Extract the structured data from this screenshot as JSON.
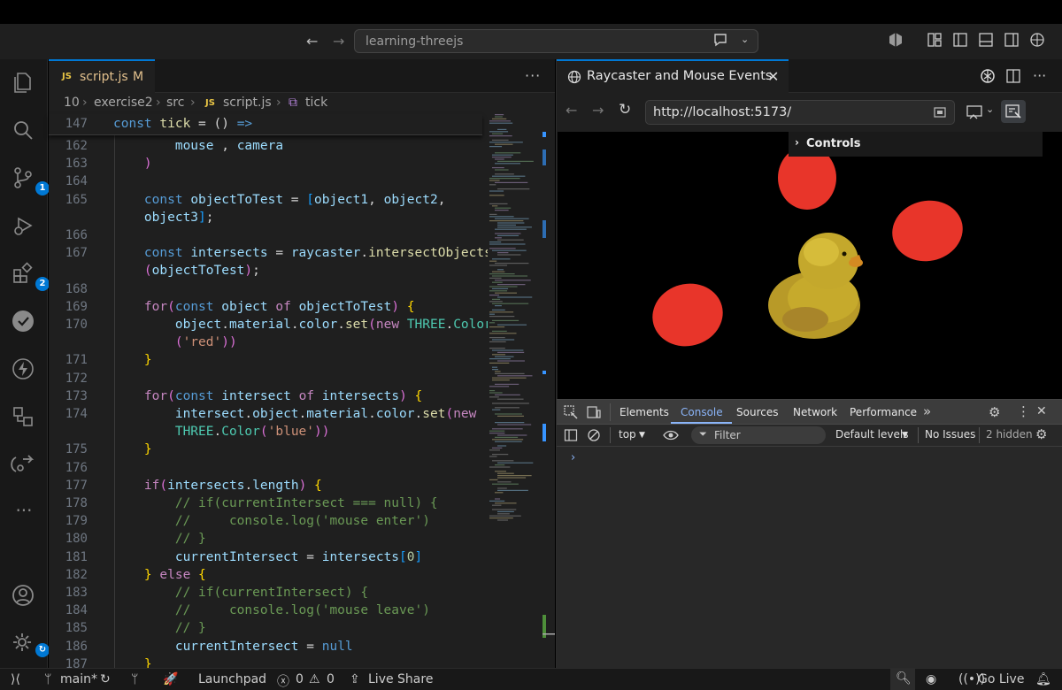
{
  "titlebar": {
    "search_text": "learning-threejs"
  },
  "activity": {
    "source_control_badge": "1",
    "extensions_badge": "2"
  },
  "editor": {
    "tab": {
      "icon_text": "JS",
      "filename": "script.js",
      "modified": "M"
    },
    "breadcrumb": [
      "10",
      "exercise2",
      "src",
      "script.js",
      "tick"
    ],
    "sticky": {
      "line": "147",
      "code": "const tick = () =>"
    },
    "line_numbers": [
      "162",
      "163",
      "164",
      "165",
      "",
      "166",
      "167",
      "",
      "168",
      "169",
      "170",
      "",
      "171",
      "172",
      "173",
      "174",
      "",
      "175",
      "176",
      "177",
      "178",
      "179",
      "180",
      "181",
      "182",
      "183",
      "184",
      "185",
      "186",
      "187"
    ],
    "lines": [
      "        mouse , camera",
      "    )",
      "",
      "    const objectToTest = [object1, object2,",
      "    object3];",
      "",
      "    const intersects = raycaster.intersectObjects",
      "    (objectToTest);",
      "",
      "    for(const object of objectToTest) {",
      "        object.material.color.set(new THREE.Color",
      "        ('red'))",
      "    }",
      "",
      "    for(const intersect of intersects) {",
      "        intersect.object.material.color.set(new",
      "        THREE.Color('blue'))",
      "    }",
      "",
      "    if(intersects.length) {",
      "        // if(currentIntersect === null) {",
      "        //     console.log('mouse enter')",
      "        // }",
      "        currentIntersect = intersects[0]",
      "    } else {",
      "        // if(currentIntersect) {",
      "        //     console.log('mouse leave')",
      "        // }",
      "        currentIntersect = null",
      "    }"
    ]
  },
  "browser": {
    "tab_title": "Raycaster and Mouse Events",
    "url": "http://localhost:5173/",
    "controls_label": "Controls"
  },
  "devtools": {
    "tabs": [
      "Elements",
      "Console",
      "Sources",
      "Network",
      "Performance"
    ],
    "active_tab": "Console",
    "context": "top",
    "filter_placeholder": "Filter",
    "levels": "Default levels",
    "issues": "No Issues",
    "hidden": "2 hidden",
    "prompt": "›"
  },
  "statusbar": {
    "branch": "main*",
    "launchpad": "Launchpad",
    "errors": "0",
    "warnings": "0",
    "live_share": "Live Share",
    "go_live": "Go Live"
  },
  "colors": {
    "accent": "#0078d4",
    "sphere": "#e8352a",
    "duck": "#c6aa2c"
  }
}
